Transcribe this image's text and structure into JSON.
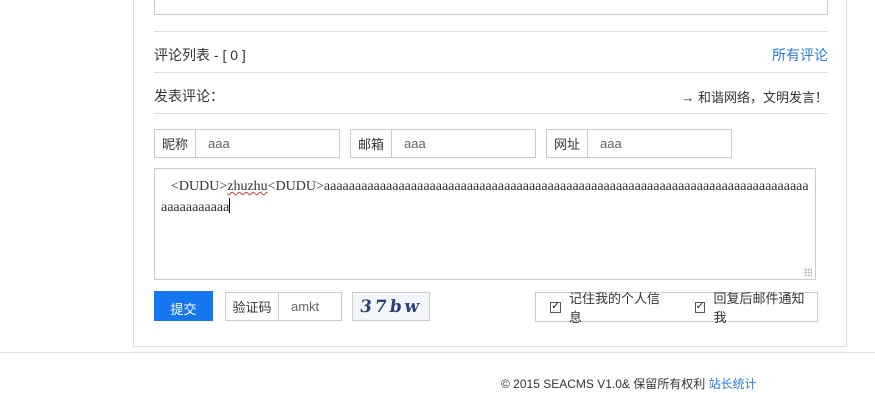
{
  "comments": {
    "list_title": "评论列表 - [ 0 ]",
    "all_comments_link": "所有评论",
    "post_title": "发表评论：",
    "notice": "→ 和谐网络，文明发言！"
  },
  "form": {
    "nickname": {
      "label": "昵称",
      "value": "aaa"
    },
    "email": {
      "label": "邮箱",
      "value": "aaa"
    },
    "website": {
      "label": "网址",
      "value": "aaa"
    },
    "content": {
      "tag_open": "<DUDU>",
      "word": "zhuzhu",
      "tag_close": "<DUDU>",
      "tail": "aaaaaaaaaaaaaaaaaaaaaaaaaaaaaaaaaaaaaaaaaaaaaaaaaaaaaaaaaaaaaaaaaaaaaaaaaaaaaaaaaaaaaaaaa"
    },
    "submit_label": "提交",
    "captcha": {
      "label": "验证码",
      "value": "amkt",
      "image_text": "37bw"
    },
    "remember_label": "记住我的个人信息",
    "notify_label": "回复后邮件通知我",
    "remember_checked": true,
    "notify_checked": true
  },
  "footer": {
    "copyright": "© 2015 SEACMS V1.0& 保留所有权利",
    "stats_link": "站长统计"
  },
  "colors": {
    "accent": "#1676f0",
    "link": "#2b7bd6",
    "border": "#cccccc"
  }
}
